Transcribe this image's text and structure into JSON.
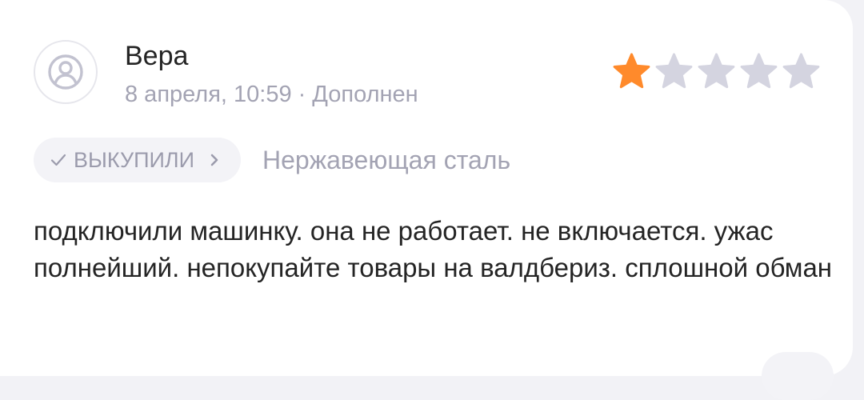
{
  "review": {
    "author": "Вера",
    "date": "8 апреля, 10:59",
    "separator": "·",
    "status": "Дополнен",
    "rating": 1,
    "max_rating": 5,
    "badge_label": "ВЫКУПИЛИ",
    "variant": "Нержавеющая сталь",
    "text": "подключили машинку. она не работает. не включается. ужас полнейший. непокупайте товары на валдбериз. сплошной обман"
  },
  "colors": {
    "star_filled": "#ff8a2b",
    "star_empty": "#d4d4e0",
    "text_primary": "#242424",
    "text_secondary": "#a3a3b3"
  },
  "icons": {
    "avatar": "user-circle-icon",
    "check": "check-icon",
    "chevron": "chevron-right-icon",
    "star": "star-icon"
  }
}
